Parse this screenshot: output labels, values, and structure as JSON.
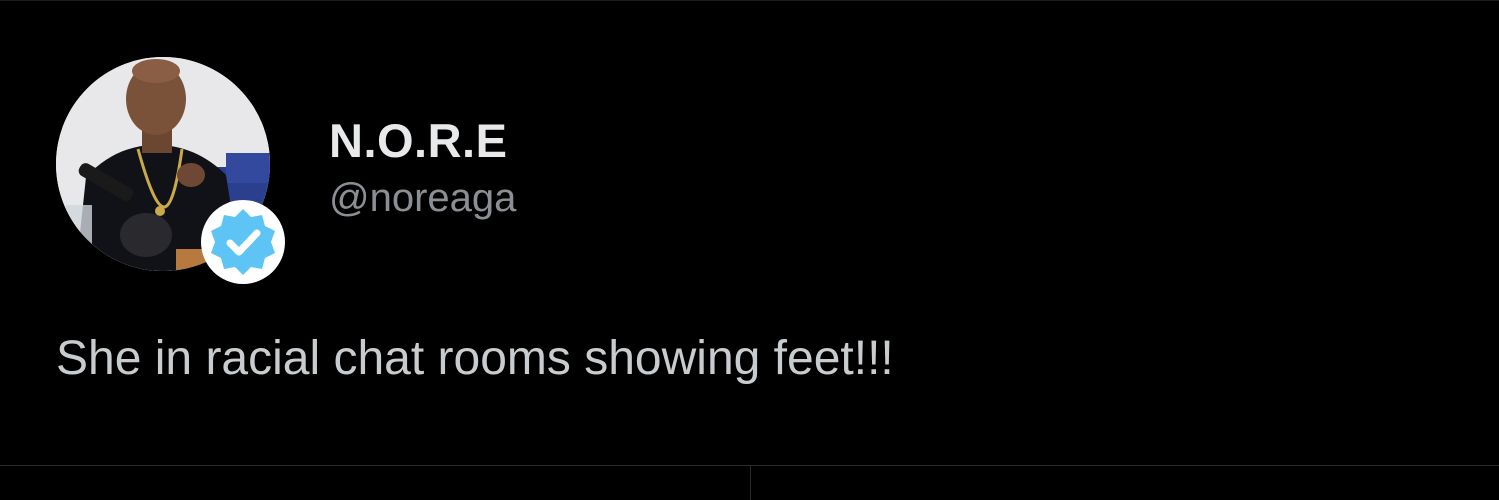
{
  "author": {
    "display_name": "N.O.R.E",
    "handle": "@noreaga",
    "verified": true,
    "avatar_icon": "profile-photo",
    "badge_icon": "verified-check-icon",
    "badge_color": "#5ec4f6"
  },
  "tweet": {
    "text": "She in racial chat rooms showing feet!!!"
  },
  "theme": {
    "background": "#000000",
    "name_color": "#e7e9ea",
    "handle_color": "#8b8f93",
    "text_color": "#c9cccf"
  }
}
